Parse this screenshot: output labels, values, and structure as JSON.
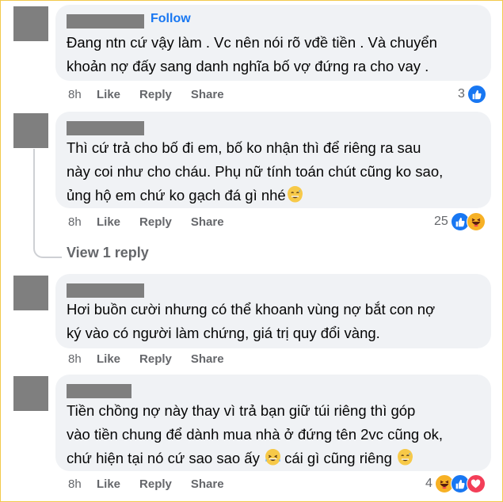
{
  "comments": [
    {
      "follow_label": "Follow",
      "text": "Đang ntn cứ vậy làm . Vc nên nói rõ vđề tiền . Và chuyển\nkhoản nợ đấy sang danh nghĩa bố vợ đứng ra cho vay .",
      "time": "8h",
      "like_label": "Like",
      "reply_label": "Reply",
      "share_label": "Share",
      "reaction_count": "3",
      "reactions": [
        "like"
      ]
    },
    {
      "text_1": "Thì cứ trả cho bố đi em, bố ko nhận thì để riêng ra sau\nnày coi như cho cháu. Phụ nữ tính toán chút cũng ko sao,\nủng hộ em chứ ko gạch đá gì nhé",
      "emoji_1": "grinning-sweat-emoji",
      "time": "8h",
      "like_label": "Like",
      "reply_label": "Reply",
      "share_label": "Share",
      "reaction_count": "25",
      "reactions": [
        "like",
        "haha"
      ],
      "view_replies_label": "View 1 reply"
    },
    {
      "text": "Hơi buồn cười nhưng có thể khoanh vùng nợ bắt con nợ\nký vào có người làm chứng, giá trị quy đổi vàng.",
      "time": "8h",
      "like_label": "Like",
      "reply_label": "Reply",
      "share_label": "Share"
    },
    {
      "text_1": "Tiền chồng nợ này thay vì trả bạn giữ túi riêng thì góp\nvào tiền chung để dành mua nhà ở đứng tên 2vc cũng ok,\nchứ hiện tại nó cứ sao sao ấy ",
      "emoji_1": "laughing-tears-emoji",
      "text_2": " cái gì cũng riêng ",
      "emoji_2": "grinning-sweat-emoji",
      "time": "8h",
      "like_label": "Like",
      "reply_label": "Reply",
      "share_label": "Share",
      "reaction_count": "4",
      "reactions": [
        "haha",
        "like",
        "love"
      ]
    }
  ],
  "colors": {
    "bubble": "#f0f2f5",
    "meta_text": "#65676b",
    "link_blue": "#1877f2",
    "redacted": "#7f7f7f",
    "like_reaction": "#1877f2",
    "haha_reaction": "#f7b125",
    "love_reaction": "#f33e58",
    "frame_border": "#f2c94c"
  }
}
